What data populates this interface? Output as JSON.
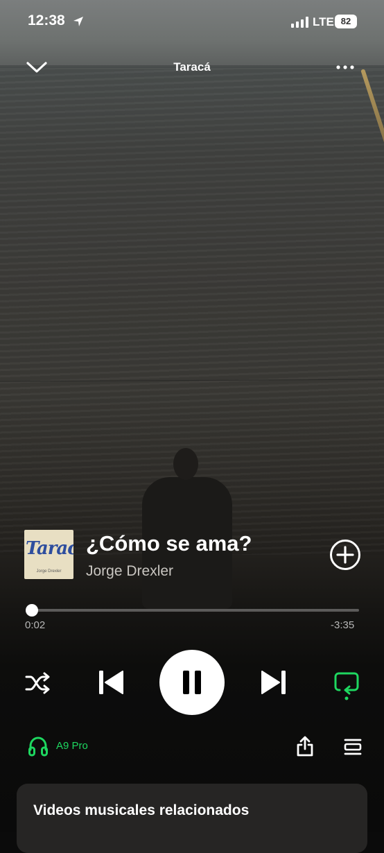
{
  "status": {
    "time": "12:38",
    "network": "LTE",
    "battery": "82"
  },
  "header": {
    "title": "Taracá"
  },
  "song": {
    "art_text": "Taracá",
    "art_subtext": "Jorge Drexler",
    "title": "¿Cómo se ama?",
    "artist": "Jorge Drexler"
  },
  "progress": {
    "elapsed": "0:02",
    "remaining": "-3:35",
    "fraction": 0.01
  },
  "device": {
    "name": "A9 Pro"
  },
  "card": {
    "title": "Videos musicales relacionados"
  },
  "colors": {
    "accent": "#1ed760",
    "card": "#262524"
  },
  "icons": [
    "location-arrow-icon",
    "signal-icon",
    "chevron-down-icon",
    "more-icon",
    "add-icon",
    "shuffle-icon",
    "previous-icon",
    "pause-icon",
    "next-icon",
    "repeat-icon",
    "headphones-icon",
    "share-icon",
    "queue-icon"
  ]
}
